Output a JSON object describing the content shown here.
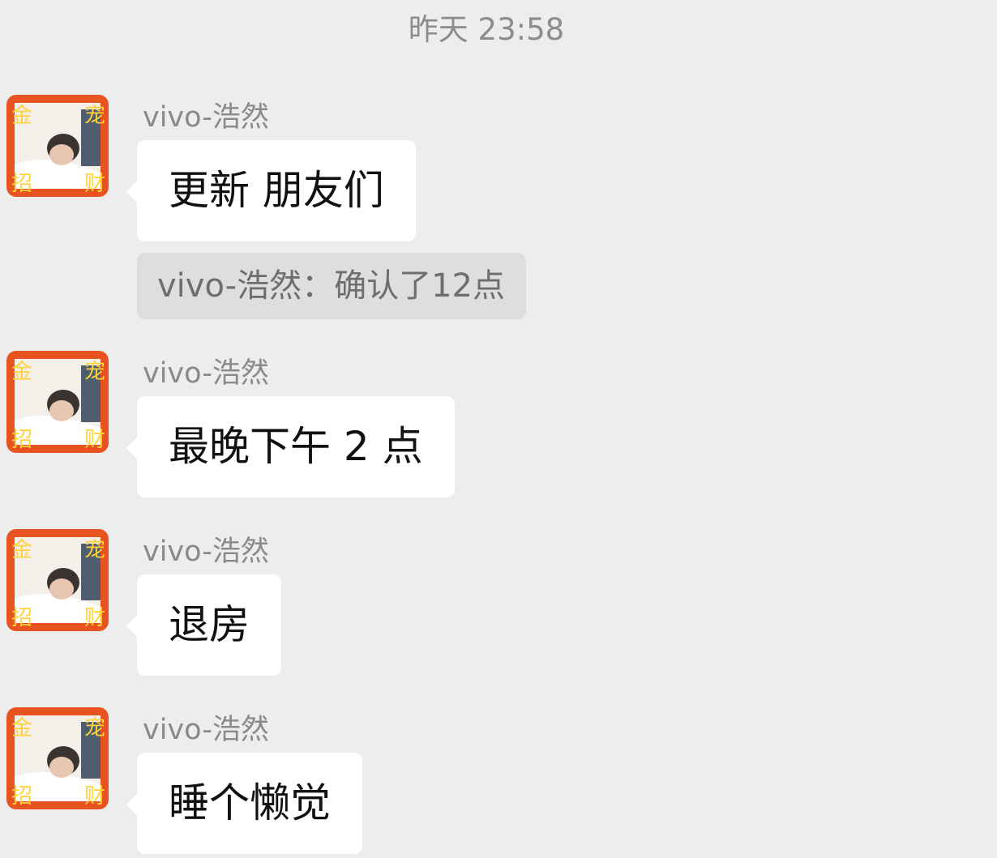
{
  "timestamp": "昨天  23:58",
  "quote": {
    "text": "vivo-浩然：确认了12点"
  },
  "messages": [
    {
      "sender": "vivo-浩然",
      "text": "更新  朋友们",
      "avatar_icon": "user-avatar-photo"
    },
    {
      "sender": "vivo-浩然",
      "text": "最晚下午 2 点",
      "avatar_icon": "user-avatar-photo"
    },
    {
      "sender": "vivo-浩然",
      "text": "退房",
      "avatar_icon": "user-avatar-photo"
    },
    {
      "sender": "vivo-浩然",
      "text": "睡个懒觉",
      "avatar_icon": "user-avatar-photo"
    }
  ],
  "colors": {
    "background": "#ededed",
    "bubble": "#ffffff",
    "quote_bg": "#dedede",
    "avatar_frame": "#e8531f"
  }
}
